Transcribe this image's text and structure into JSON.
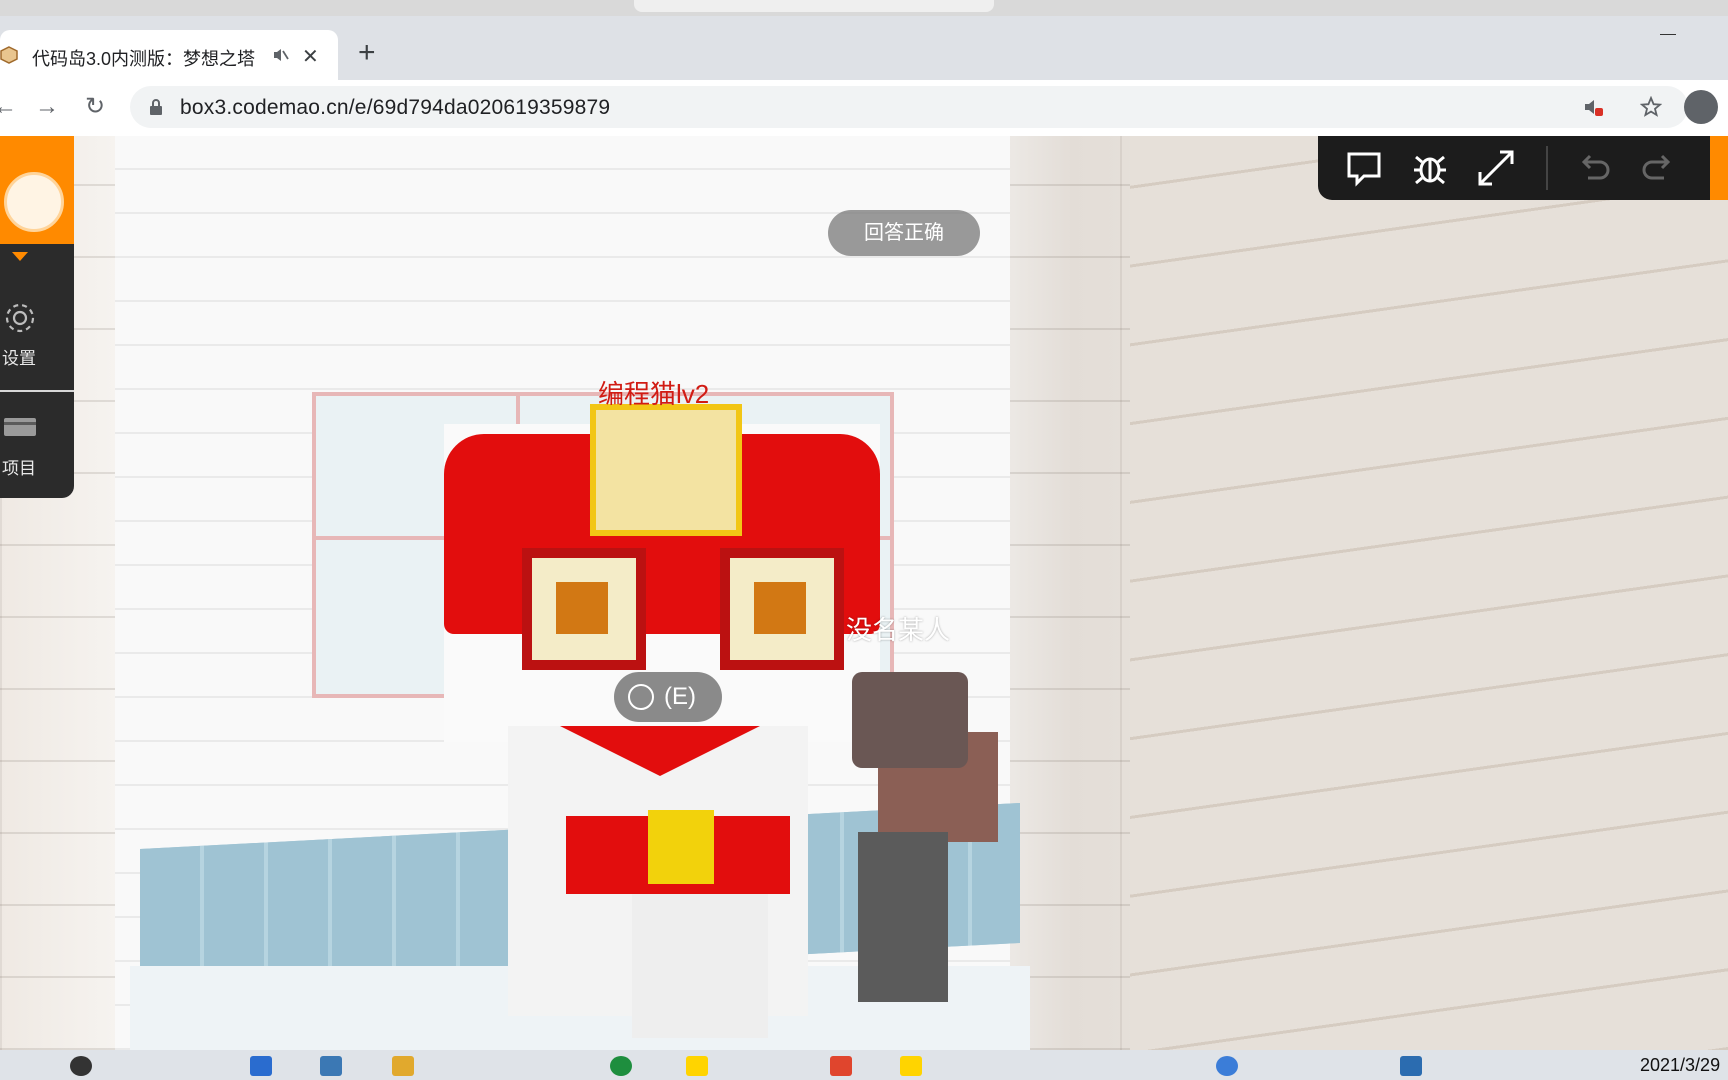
{
  "browser": {
    "tab_title": "代码岛3.0内测版：梦想之塔",
    "tab_close": "✕",
    "new_tab": "+",
    "url": "box3.codemao.cn/e/69d794da020619359879"
  },
  "game": {
    "answer_button": "回答正确",
    "cat_nametag": "编程猫lv2",
    "npc_nametag": "没名某人",
    "interact_key": "(E)"
  },
  "sidebar": {
    "items": [
      {
        "label": "设置",
        "icon": "gear-icon"
      },
      {
        "label": "项目",
        "icon": "folder-icon"
      }
    ]
  },
  "toolbar": {
    "icons": [
      "chat-icon",
      "bug-icon",
      "fullscreen-icon",
      "undo-icon",
      "redo-icon"
    ]
  },
  "taskbar": {
    "date": "2021/3/29"
  },
  "colors": {
    "accent": "#ff8a00",
    "toolbar_bg": "#1c1c1c",
    "cat_tag": "#d11b13"
  }
}
